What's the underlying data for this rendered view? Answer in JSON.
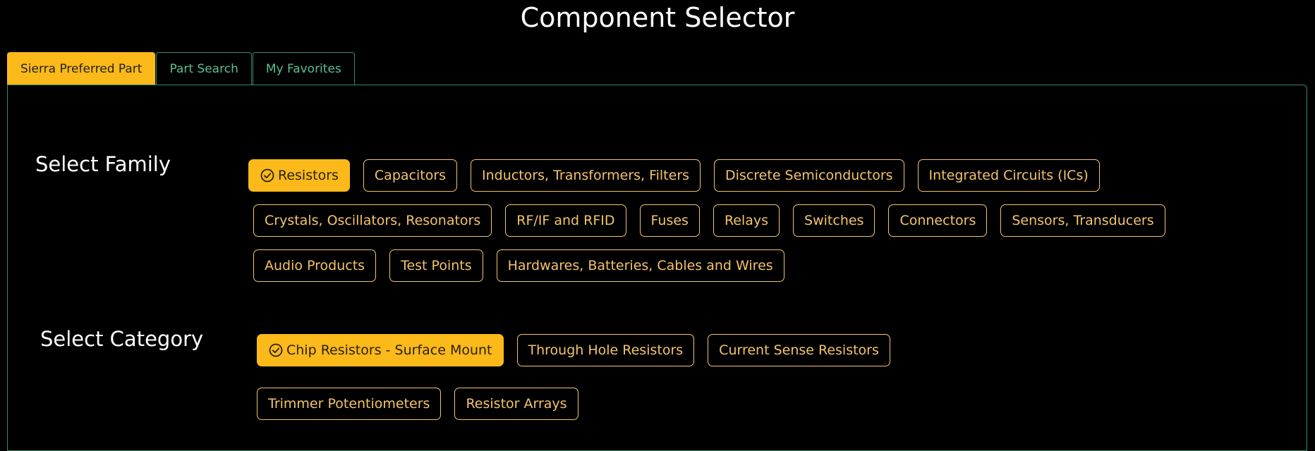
{
  "page": {
    "title": "Component Selector"
  },
  "tabs": [
    {
      "label": "Sierra Preferred Part",
      "active": true
    },
    {
      "label": "Part Search",
      "active": false
    },
    {
      "label": "My Favorites",
      "active": false
    }
  ],
  "family": {
    "label": "Select Family",
    "rows": [
      [
        "Resistors",
        "Capacitors",
        "Inductors, Transformers, Filters",
        "Discrete Semiconductors",
        "Integrated Circuits (ICs)"
      ],
      [
        "Crystals, Oscillators, Resonators",
        "RF/IF and RFID",
        "Fuses",
        "Relays",
        "Switches",
        "Connectors",
        "Sensors, Transducers"
      ],
      [
        "Audio Products",
        "Test Points",
        "Hardwares, Batteries, Cables and Wires"
      ]
    ],
    "selected": "Resistors"
  },
  "category": {
    "label": "Select Category",
    "rows": [
      [
        "Chip Resistors - Surface Mount",
        "Through Hole Resistors",
        "Current Sense Resistors"
      ],
      [
        "Trimmer Potentiometers",
        "Resistor Arrays"
      ]
    ],
    "selected": "Chip Resistors - Surface Mount"
  },
  "icons": {
    "selected_marker": "check-circle-icon"
  },
  "colors": {
    "accent": "#fbb91a",
    "chip_outline": "#f3c46b",
    "tab_outline": "#2f8c66",
    "tab_text": "#5dbf8f",
    "background": "#000000"
  }
}
